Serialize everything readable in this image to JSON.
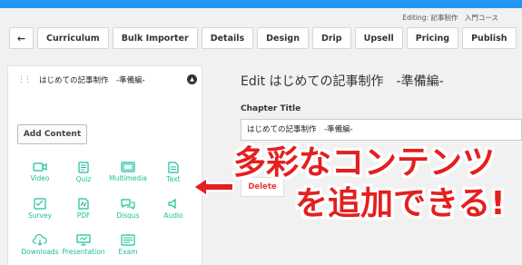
{
  "header": {
    "accent_color": "#2196f3",
    "editing_label": "Editing:",
    "editing_course": "記事制作　入門コース"
  },
  "toolbar": {
    "back_icon": "arrow-left-icon",
    "back_label": "←",
    "tabs": [
      "Curriculum",
      "Bulk Importer",
      "Details",
      "Design",
      "Drip",
      "Upsell",
      "Pricing",
      "Publish"
    ]
  },
  "sidebar": {
    "drag_icon": "drag-handle-icon",
    "drag_glyph": "⋮⋮",
    "chapter_name": "はじめての記事制作　-準備編-",
    "collapse_icon": "chevron-up-icon",
    "collapse_glyph": "▲",
    "add_content_label": "Add Content",
    "content_types": [
      {
        "label": "Video",
        "icon": "video-icon"
      },
      {
        "label": "Quiz",
        "icon": "quiz-icon"
      },
      {
        "label": "Multimedia",
        "icon": "multimedia-icon"
      },
      {
        "label": "Text",
        "icon": "text-icon"
      },
      {
        "label": "Survey",
        "icon": "survey-icon"
      },
      {
        "label": "PDF",
        "icon": "pdf-icon"
      },
      {
        "label": "Disqus",
        "icon": "disqus-icon"
      },
      {
        "label": "Audio",
        "icon": "audio-icon"
      },
      {
        "label": "Downloads",
        "icon": "downloads-icon"
      },
      {
        "label": "Presentation",
        "icon": "presentation-icon"
      },
      {
        "label": "Exam",
        "icon": "exam-icon"
      }
    ],
    "icon_color": "#1bbf9a"
  },
  "main": {
    "title": "Edit はじめての記事制作　-準備編-",
    "chapter_title_label": "Chapter Title",
    "chapter_title_value": "はじめての記事制作　-準備編-",
    "delete_label": "Delete",
    "delete_color": "#e53935"
  },
  "overlay": {
    "line1": "多彩なコンテンツ",
    "line2": "を追加できる!",
    "color": "#e41f1f",
    "arrow_icon": "arrow-left-icon"
  }
}
